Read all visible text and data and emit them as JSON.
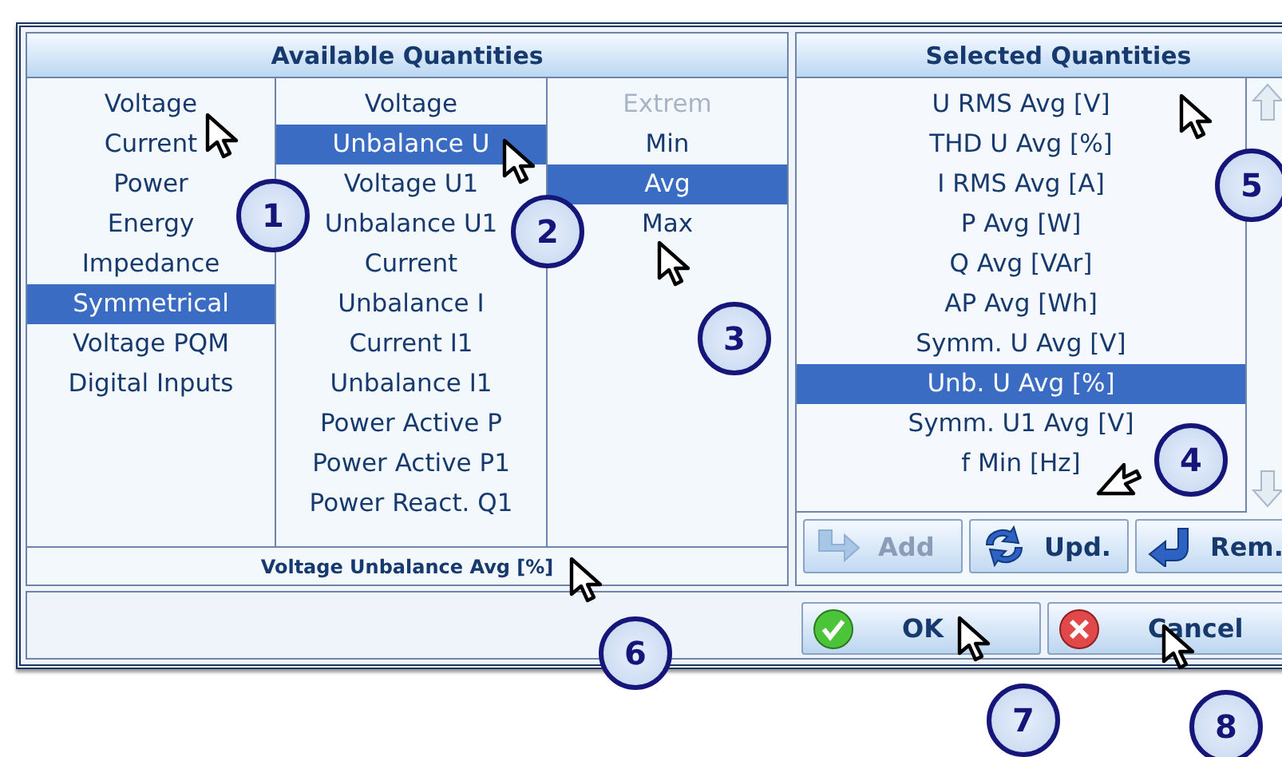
{
  "available": {
    "title": "Available Quantities",
    "categories": [
      {
        "label": "Voltage",
        "selected": false
      },
      {
        "label": "Current",
        "selected": false
      },
      {
        "label": "Power",
        "selected": false
      },
      {
        "label": "Energy",
        "selected": false
      },
      {
        "label": "Impedance",
        "selected": false
      },
      {
        "label": "Symmetrical",
        "selected": true
      },
      {
        "label": "Voltage PQM",
        "selected": false
      },
      {
        "label": "Digital Inputs",
        "selected": false
      }
    ],
    "quantities": [
      {
        "label": "Voltage",
        "selected": false
      },
      {
        "label": "Unbalance U",
        "selected": true
      },
      {
        "label": "Voltage U1",
        "selected": false
      },
      {
        "label": "Unbalance U1",
        "selected": false
      },
      {
        "label": "Current",
        "selected": false
      },
      {
        "label": "Unbalance I",
        "selected": false
      },
      {
        "label": "Current I1",
        "selected": false
      },
      {
        "label": "Unbalance I1",
        "selected": false
      },
      {
        "label": "Power Active P",
        "selected": false
      },
      {
        "label": "Power Active P1",
        "selected": false
      },
      {
        "label": "Power React. Q1",
        "selected": false
      }
    ],
    "modes": [
      {
        "label": "Extrem",
        "selected": false,
        "disabled": true
      },
      {
        "label": "Min",
        "selected": false,
        "disabled": false
      },
      {
        "label": "Avg",
        "selected": true,
        "disabled": false
      },
      {
        "label": "Max",
        "selected": false,
        "disabled": false
      }
    ],
    "description": "Voltage Unbalance Avg [%]"
  },
  "selected_quantities": {
    "title": "Selected Quantities",
    "items": [
      {
        "label": "U RMS Avg [V]",
        "selected": false
      },
      {
        "label": "THD U Avg [%]",
        "selected": false
      },
      {
        "label": "I RMS Avg [A]",
        "selected": false
      },
      {
        "label": "P Avg [W]",
        "selected": false
      },
      {
        "label": "Q Avg [VAr]",
        "selected": false
      },
      {
        "label": "AP Avg [Wh]",
        "selected": false
      },
      {
        "label": "Symm. U Avg [V]",
        "selected": false
      },
      {
        "label": "Unb. U Avg [%]",
        "selected": true
      },
      {
        "label": "Symm. U1 Avg [V]",
        "selected": false
      },
      {
        "label": "f Min [Hz]",
        "selected": false
      }
    ],
    "buttons": [
      {
        "label": "Add",
        "kind": "add",
        "disabled": true
      },
      {
        "label": "Upd.",
        "kind": "update",
        "disabled": false
      },
      {
        "label": "Rem.",
        "kind": "remove",
        "disabled": false
      }
    ]
  },
  "dialog_buttons": [
    {
      "label": "OK",
      "kind": "ok"
    },
    {
      "label": "Cancel",
      "kind": "cancel"
    }
  ],
  "callouts": [
    {
      "number": "1"
    },
    {
      "number": "2"
    },
    {
      "number": "3"
    },
    {
      "number": "4"
    },
    {
      "number": "5"
    },
    {
      "number": "6"
    },
    {
      "number": "7"
    },
    {
      "number": "8"
    }
  ]
}
